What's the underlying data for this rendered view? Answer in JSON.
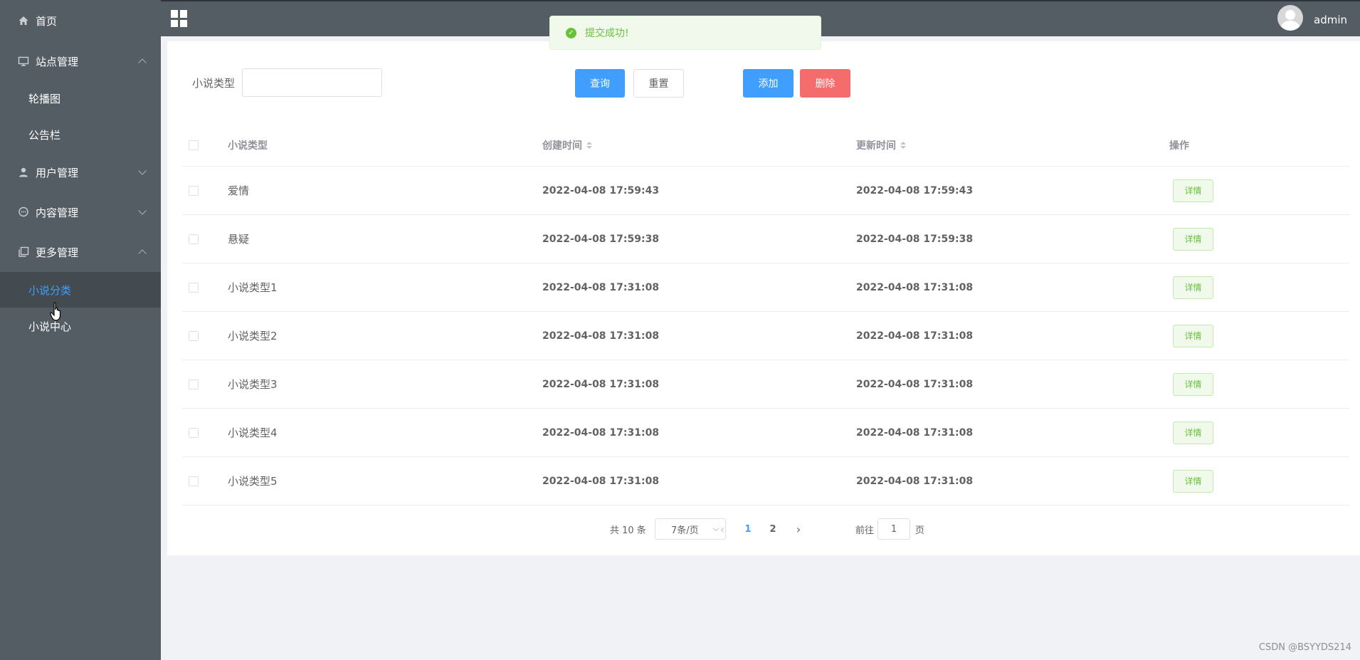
{
  "header": {
    "title": "",
    "username": "admin"
  },
  "toast": {
    "message": "提交成功!",
    "color": "#67c23a"
  },
  "sidebar": {
    "bg_color": "#545c64",
    "active_color": "#409eff",
    "items": [
      {
        "label": "首页",
        "icon": "home-icon"
      },
      {
        "label": "站点管理",
        "icon": "monitor-icon",
        "expanded": true,
        "children": [
          {
            "label": "轮播图"
          },
          {
            "label": "公告栏"
          }
        ]
      },
      {
        "label": "用户管理",
        "icon": "user-icon",
        "expanded": false
      },
      {
        "label": "内容管理",
        "icon": "chat-icon",
        "expanded": false
      },
      {
        "label": "更多管理",
        "icon": "copy-icon",
        "expanded": true,
        "children": [
          {
            "label": "小说分类",
            "active": true
          },
          {
            "label": "小说中心"
          }
        ]
      }
    ]
  },
  "search": {
    "label": "小说类型",
    "value": "",
    "placeholder": ""
  },
  "toolbar": {
    "query": "查询",
    "reset": "重置",
    "add": "添加",
    "delete": "删除"
  },
  "table": {
    "columns": [
      "小说类型",
      "创建时间",
      "更新时间",
      "操作"
    ],
    "action_label": "详情",
    "rows": [
      {
        "type": "爱情",
        "created": "2022-04-08 17:59:43",
        "updated": "2022-04-08 17:59:43"
      },
      {
        "type": "悬疑",
        "created": "2022-04-08 17:59:38",
        "updated": "2022-04-08 17:59:38"
      },
      {
        "type": "小说类型1",
        "created": "2022-04-08 17:31:08",
        "updated": "2022-04-08 17:31:08"
      },
      {
        "type": "小说类型2",
        "created": "2022-04-08 17:31:08",
        "updated": "2022-04-08 17:31:08"
      },
      {
        "type": "小说类型3",
        "created": "2022-04-08 17:31:08",
        "updated": "2022-04-08 17:31:08"
      },
      {
        "type": "小说类型4",
        "created": "2022-04-08 17:31:08",
        "updated": "2022-04-08 17:31:08"
      },
      {
        "type": "小说类型5",
        "created": "2022-04-08 17:31:08",
        "updated": "2022-04-08 17:31:08"
      }
    ]
  },
  "pagination": {
    "total": "共 10 条",
    "page_size": "7条/页",
    "pages": [
      "1",
      "2"
    ],
    "current": "1",
    "goto_label": "前往",
    "goto_value": "1",
    "page_suffix": "页"
  },
  "watermark": "CSDN @BSYYDS214"
}
